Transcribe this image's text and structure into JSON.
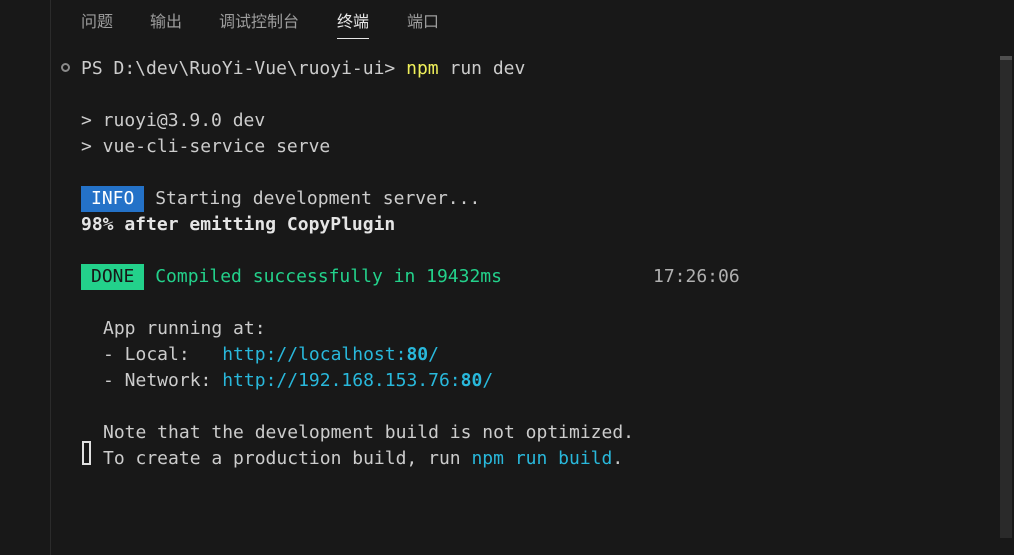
{
  "tabs": [
    {
      "label": "问题"
    },
    {
      "label": "输出"
    },
    {
      "label": "调试控制台"
    },
    {
      "label": "终端"
    },
    {
      "label": "端口"
    }
  ],
  "active_tab": "终端",
  "terminal": {
    "prompt": "PS D:\\dev\\RuoYi-Vue\\ruoyi-ui>",
    "command_name": "npm",
    "command_args": "run dev",
    "script_line1": "> ruoyi@3.9.0 dev",
    "script_line2": "> vue-cli-service serve",
    "info_badge": "INFO",
    "info_text": "Starting development server...",
    "progress_text": "98% after emitting CopyPlugin",
    "done_badge": "DONE",
    "done_text": "Compiled successfully in 19432ms",
    "done_time": "17:26:06",
    "app_running": "App running at:",
    "local_label": "- Local:   ",
    "local_url_prefix": "http://localhost:",
    "local_port": "80",
    "local_url_suffix": "/",
    "network_label": "- Network: ",
    "network_url_prefix": "http://192.168.153.76:",
    "network_port": "80",
    "network_url_suffix": "/",
    "note_line": "Note that the development build is not optimized.",
    "build_prefix": "To create a production build, run ",
    "build_cmd": "npm run build",
    "build_suffix": "."
  },
  "colors": {
    "background": "#181818",
    "info_badge": "#2472c8",
    "done_badge": "#23d18b",
    "url": "#29b8db",
    "command": "#f0f05a"
  }
}
